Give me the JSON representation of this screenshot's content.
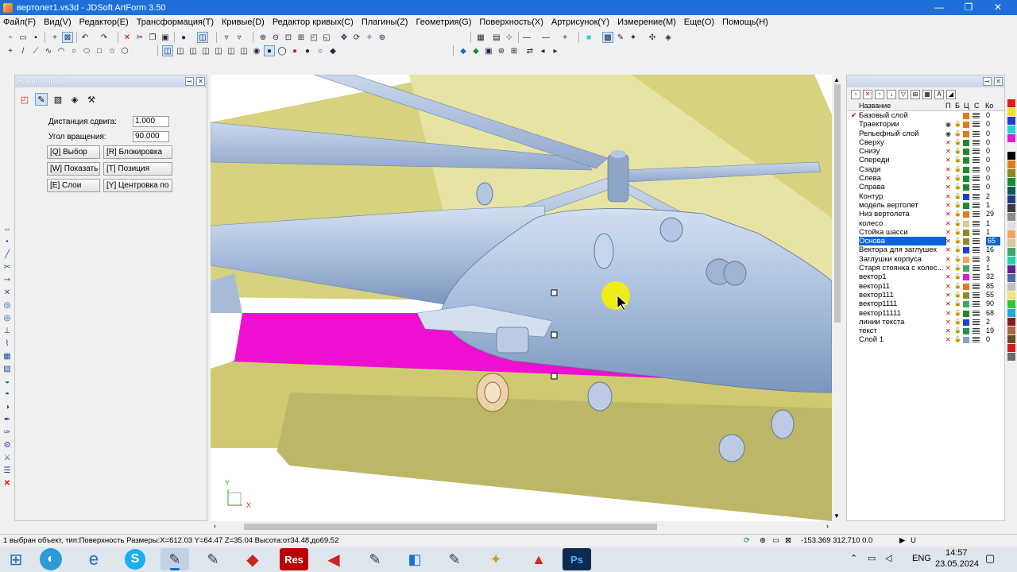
{
  "window": {
    "title": "вертолет1.vs3d - JDSoft ArtForm 3.50",
    "minimize": "—",
    "maximize": "❐",
    "close": "✕"
  },
  "menu": [
    "Файл(F)",
    "Вид(V)",
    "Редактор(E)",
    "Трансформация(T)",
    "Кривые(D)",
    "Редактор кривых(C)",
    "Плагины(Z)",
    "Геометрия(G)",
    "Поверхность(X)",
    "Артрисунок(Y)",
    "Измерение(M)",
    "Еще(O)",
    "Помощь(H)"
  ],
  "navigator": {
    "title": "Навигатор(3)",
    "shift_label": "Дистанция сдвига:",
    "shift_value": "1.000",
    "rotation_label": "Угол вращения:",
    "rotation_value": "90.000",
    "buttons": [
      "[Q] Выбор",
      "[R] Блокировка",
      "[W] Показать",
      "[T] Позиция",
      "[E] Слои",
      "[Y] Центровка по"
    ]
  },
  "viewport": {
    "axis_y": "Y",
    "axis_x": "X"
  },
  "layers": {
    "title": "Слой",
    "col_name": "Название",
    "col_p": "П",
    "col_b": "Б",
    "col_c": "Ц",
    "col_s": "С",
    "col_count": "Ко",
    "rows": [
      {
        "name": "Базовый слой",
        "color": "#e07b1a",
        "count": "0",
        "check": true
      },
      {
        "name": "Траектории",
        "color": "#e07b1a",
        "count": "0"
      },
      {
        "name": "Рельефный слой",
        "color": "#e07b1a",
        "count": "0"
      },
      {
        "name": "Сверху",
        "color": "#1c8a2e",
        "count": "0"
      },
      {
        "name": "Снизу",
        "color": "#1c8a2e",
        "count": "0"
      },
      {
        "name": "Спереди",
        "color": "#1c8a2e",
        "count": "0"
      },
      {
        "name": "Сзади",
        "color": "#1c8a2e",
        "count": "0"
      },
      {
        "name": "Слева",
        "color": "#1c8a2e",
        "count": "0"
      },
      {
        "name": "Справа",
        "color": "#1c8a2e",
        "count": "0"
      },
      {
        "name": "Контур",
        "color": "#1a3fd6",
        "count": "2"
      },
      {
        "name": "модель вертолет",
        "color": "#1c8a2e",
        "count": "1"
      },
      {
        "name": "Низ вертолета",
        "color": "#e07b1a",
        "count": "29"
      },
      {
        "name": "колесо",
        "color": "#d9c89a",
        "count": "1"
      },
      {
        "name": "Стойка шасси",
        "color": "#8a8a2a",
        "count": "1"
      },
      {
        "name": "Основа",
        "color": "#8a8a2a",
        "count": "65",
        "selected": true
      },
      {
        "name": "Вектора для заглушек",
        "color": "#1a3fd6",
        "count": "16"
      },
      {
        "name": "Заглушки корпуса",
        "color": "#f2a65a",
        "count": "3"
      },
      {
        "name": "Старя стоянка с колес...",
        "color": "#3aa86a",
        "count": "1"
      },
      {
        "name": "вектор1",
        "color": "#e01ad6",
        "count": "32"
      },
      {
        "name": "вектор11",
        "color": "#e07b1a",
        "count": "85"
      },
      {
        "name": "вектор111",
        "color": "#8a8a2a",
        "count": "55"
      },
      {
        "name": "вектор1111",
        "color": "#3aa86a",
        "count": "90"
      },
      {
        "name": "вектор11111",
        "color": "#1c8a2e",
        "count": "68"
      },
      {
        "name": "линии текста",
        "color": "#1a3fd6",
        "count": "2"
      },
      {
        "name": "текст",
        "color": "#2a8a5a",
        "count": "19"
      },
      {
        "name": "Слой 1",
        "color": "#8aa0c8",
        "count": "0"
      }
    ]
  },
  "palette": [
    "#e01a1a",
    "#f2e21a",
    "#1a3fd6",
    "#1ad6d6",
    "#e01ad6",
    "#f2f2f2",
    "#000000",
    "#e07b1a",
    "#8a8a2a",
    "#1c8a2e",
    "#0a5a5a",
    "#1a3a8a",
    "#3a3a3a",
    "#8a8a8a",
    "#e0e0e0",
    "#f2a65a",
    "#d9c89a",
    "#3aa86a",
    "#1ad6a6",
    "#6a1a8a",
    "#4a6aa8",
    "#c0c0c0",
    "#f2e27a",
    "#2ac82a",
    "#1aa8e0",
    "#8a1a1a",
    "#a86a3a",
    "#6a4a2a",
    "#d61a1a",
    "#6a6a6a"
  ],
  "status": {
    "left": "1 выбран объект, тип:Поверхность  Размеры:X=612.03 Y=64.47 Z=35.04 Высота:от34.48,до69.52",
    "coords": "-153.369 312.710 0.0",
    "u": "U"
  },
  "taskbar": {
    "lang": "ENG",
    "time": "14:57",
    "date": "23.05.2024",
    "res_label": "Res"
  }
}
